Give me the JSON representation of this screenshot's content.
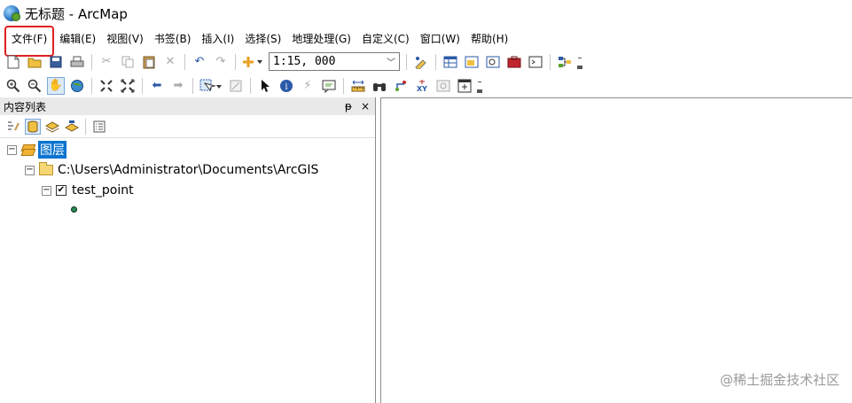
{
  "window": {
    "title": "无标题 - ArcMap"
  },
  "menu": [
    {
      "label": "文件(F)",
      "highlighted": true
    },
    {
      "label": "编辑(E)"
    },
    {
      "label": "视图(V)"
    },
    {
      "label": "书签(B)"
    },
    {
      "label": "插入(I)"
    },
    {
      "label": "选择(S)"
    },
    {
      "label": "地理处理(G)"
    },
    {
      "label": "自定义(C)"
    },
    {
      "label": "窗口(W)"
    },
    {
      "label": "帮助(H)"
    }
  ],
  "toolbar": {
    "scale_value": "1:15, 000"
  },
  "toc": {
    "title": "内容列表",
    "pin_glyph": "ᵽ",
    "close_glyph": "×",
    "root_label": "图层",
    "folder_path": "C:\\Users\\Administrator\\Documents\\ArcGIS",
    "layer_name": "test_point",
    "layer_checked": true
  },
  "watermark": "@稀土掘金技术社区",
  "colors": {
    "selection": "#0a74d0",
    "highlight_box": "#e02020",
    "point_symbol": "#2e8b57"
  }
}
